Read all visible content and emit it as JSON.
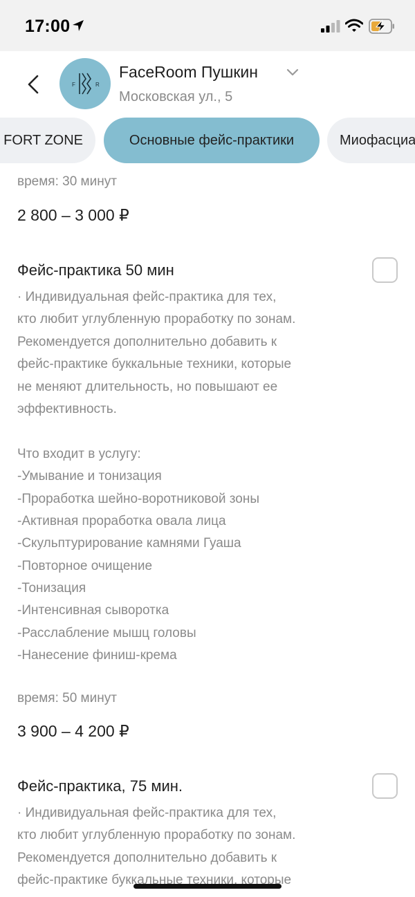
{
  "status_bar": {
    "time": "17:00"
  },
  "header": {
    "salon_name": "FaceRoom Пушкин",
    "address": "Московская ул., 5",
    "logo_letters": [
      "F",
      "R"
    ]
  },
  "tabs": [
    {
      "label": "FORT ZONE",
      "active": false
    },
    {
      "label": "Основные фейс-практики",
      "active": true
    },
    {
      "label": "Миофасциальный",
      "active": false
    }
  ],
  "prev_service": {
    "time": "время: 30 минут",
    "price": "2 800 – 3 000 ₽"
  },
  "services": [
    {
      "title": "Фейс-практика 50 мин",
      "description": [
        "· Индивидуальная фейс-практика для тех,",
        "кто любит углубленную проработку по зонам.",
        "Рекомендуется дополнительно добавить к",
        "фейс-практике буккальные техники, которые",
        "не меняют длительность, но повышают ее",
        "эффективность.",
        "",
        "Что входит в услугу:",
        "-Умывание и тонизация",
        "-Проработка шейно-воротниковой зоны",
        "-Активная проработка овала лица",
        "-Скульптурирование камнями Гуаша",
        "-Повторное очищение",
        "-Тонизация",
        "-Интенсивная сыворотка",
        "-Расслабление мышц головы",
        "-Нанесение финиш-крема"
      ],
      "time": "время: 50 минут",
      "price": "3 900 – 4 200 ₽"
    },
    {
      "title": "Фейс-практика, 75 мин.",
      "description": [
        "· Индивидуальная фейс-практика для тех,",
        "кто любит углубленную проработку по зонам.",
        "Рекомендуется дополнительно добавить к",
        "фейс-практике буккальные техники, которые"
      ]
    }
  ],
  "colors": {
    "accent": "#84bdd0",
    "tab_bg": "#eef0f3",
    "muted_text": "#8a8a8a"
  }
}
